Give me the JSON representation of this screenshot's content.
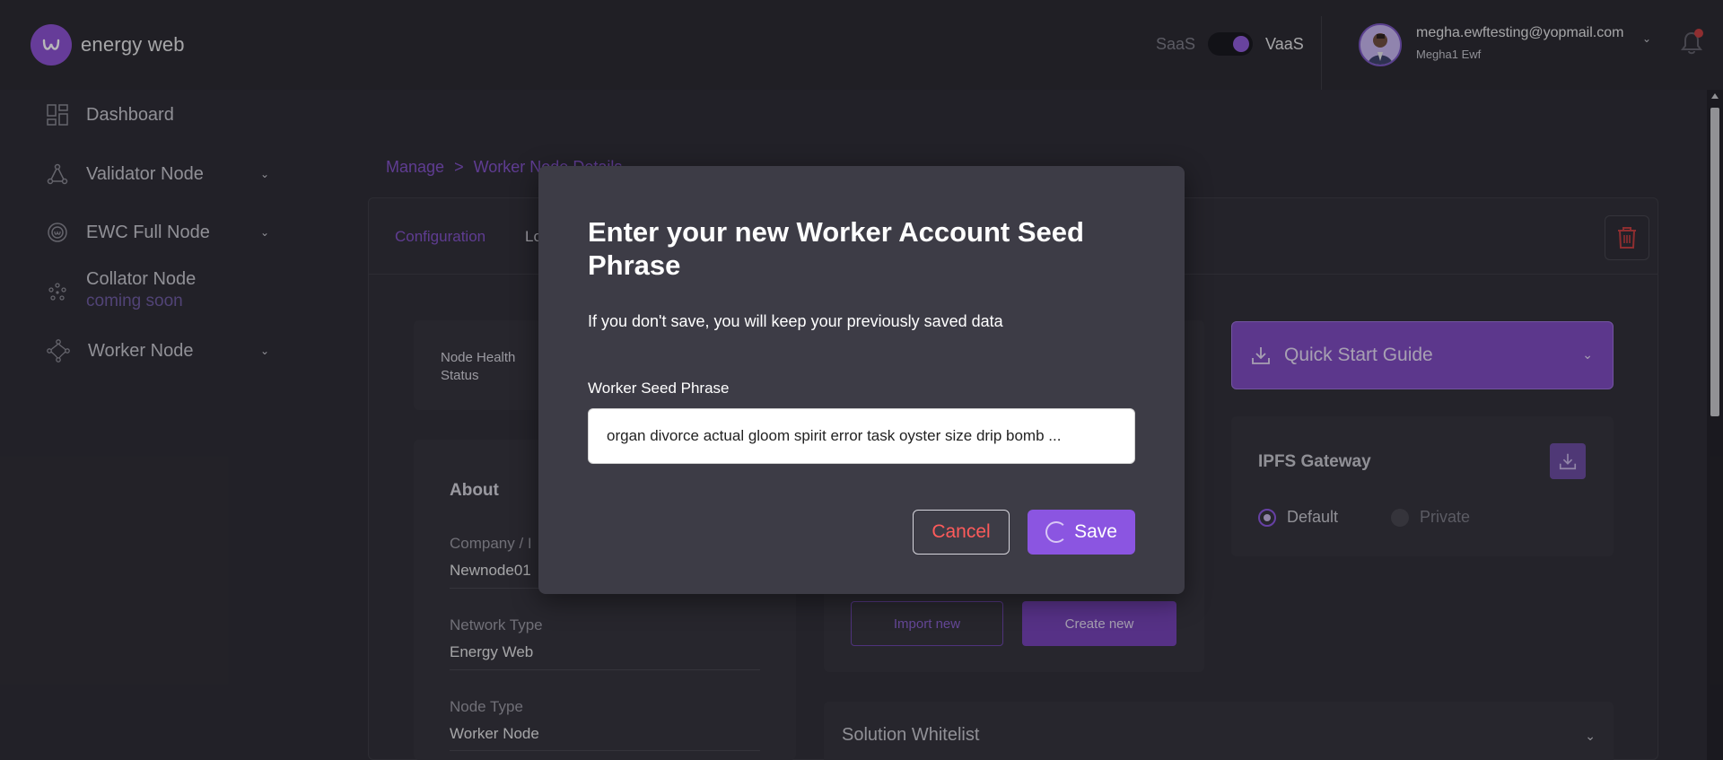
{
  "app": {
    "logo_text": "energy web"
  },
  "topbar": {
    "mode_left": "SaaS",
    "mode_right": "VaaS",
    "mode_selected": "VaaS",
    "user_email": "megha.ewftesting@yopmail.com",
    "user_name": "Megha1 Ewf"
  },
  "sidebar": {
    "items": [
      {
        "label": "Dashboard",
        "icon": "dashboard-icon"
      },
      {
        "label": "Validator Node",
        "icon": "validator-node-icon"
      },
      {
        "label": "EWC Full Node",
        "icon": "ewc-icon"
      },
      {
        "label": "Collator Node",
        "sub": "coming soon",
        "icon": "collator-icon"
      },
      {
        "label": "Worker Node",
        "icon": "worker-node-icon"
      }
    ]
  },
  "breadcrumb": {
    "root": "Manage",
    "separator": ">",
    "current": "Worker Node Details"
  },
  "tabs": {
    "configuration": "Configuration",
    "second": "Lo"
  },
  "node_health": {
    "label_line1": "Node Health",
    "label_line2": "Status"
  },
  "about": {
    "title": "About",
    "company_label": "Company / I",
    "company_value": "Newnode01",
    "network_type_label": "Network Type",
    "network_type_value": "Energy Web",
    "node_type_label": "Node Type",
    "node_type_value": "Worker Node"
  },
  "seed_actions": {
    "import_label": "Import new",
    "create_label": "Create new"
  },
  "quick_start": {
    "label": "Quick Start Guide"
  },
  "ipfs": {
    "title": "IPFS Gateway",
    "option_default": "Default",
    "option_private": "Private",
    "selected": "Default"
  },
  "whitelist": {
    "label": "Solution Whitelist"
  },
  "modal": {
    "title": "Enter your new Worker Account Seed Phrase",
    "subtitle": "If you don't save, you will keep your previously saved data",
    "field_label": "Worker Seed Phrase",
    "field_value": "organ divorce actual gloom spirit error task oyster size drip bomb ...",
    "cancel_label": "Cancel",
    "save_label": "Save"
  },
  "colors": {
    "accent": "#8b55e1",
    "cancel_text": "#ff5b5b",
    "breadcrumb": "#8250c7"
  }
}
